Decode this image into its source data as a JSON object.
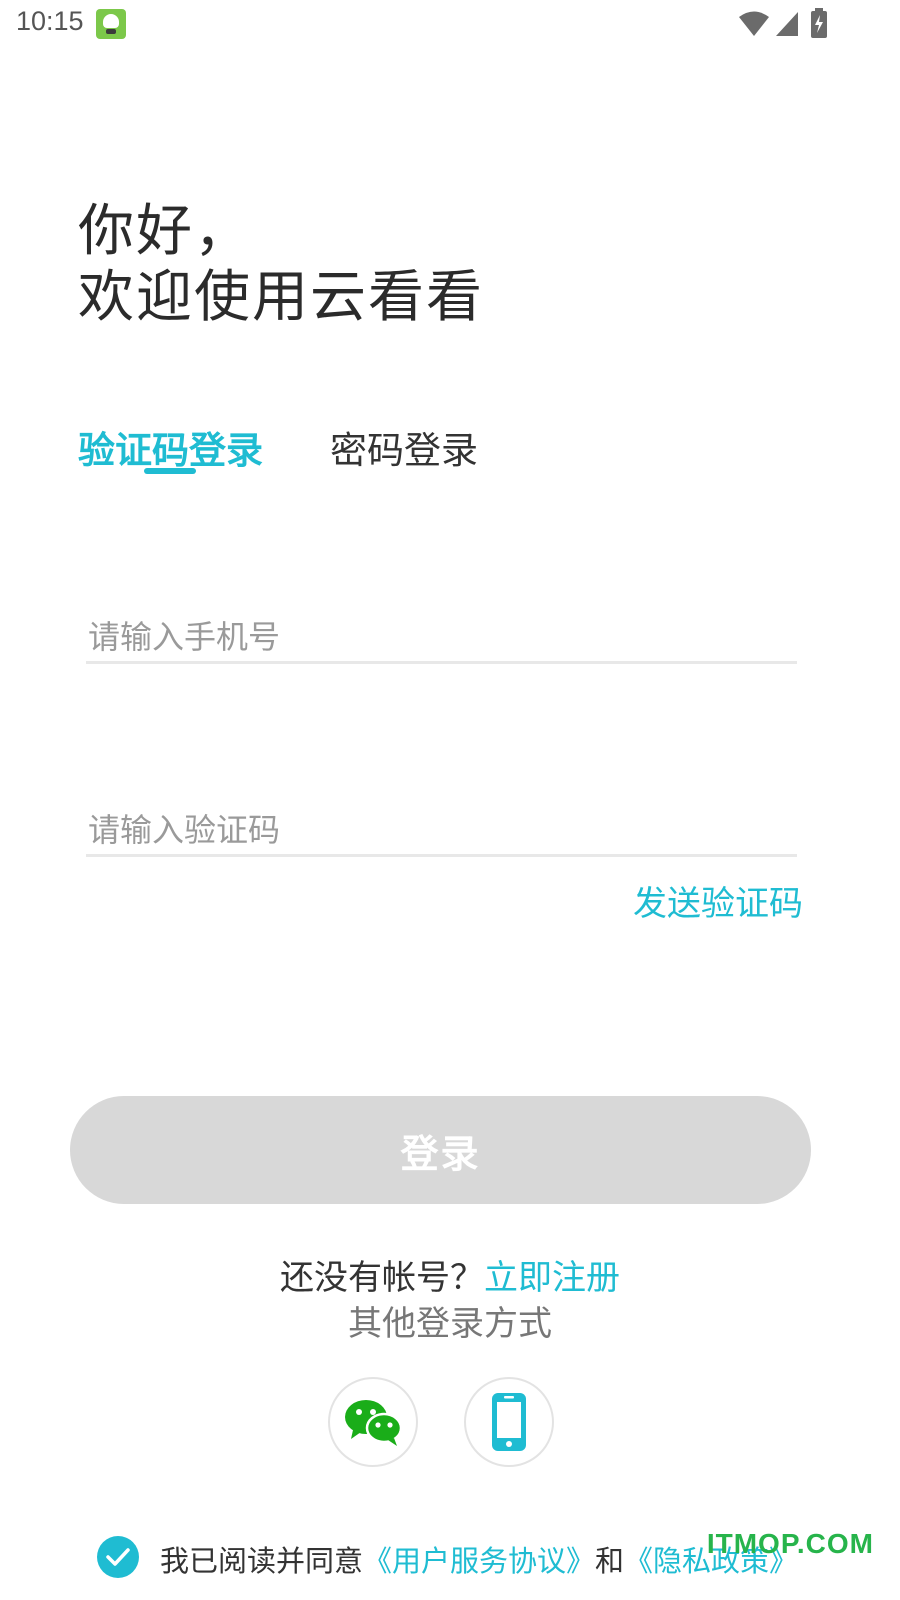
{
  "status_bar": {
    "time": "10:15",
    "icons": [
      "app-notification-icon",
      "wifi-icon",
      "cellular-signal-icon",
      "battery-charging-icon"
    ]
  },
  "welcome": {
    "line1": "你好，",
    "line2": "欢迎使用云看看"
  },
  "tabs": [
    {
      "label": "验证码登录",
      "active": true
    },
    {
      "label": "密码登录",
      "active": false
    }
  ],
  "form": {
    "phone_placeholder": "请输入手机号",
    "phone_value": "",
    "code_placeholder": "请输入验证码",
    "code_value": "",
    "send_code_label": "发送验证码"
  },
  "login_button": {
    "label": "登录",
    "enabled": false
  },
  "register": {
    "question": "还没有帐号？",
    "link": "立即注册"
  },
  "other_login": {
    "title": "其他登录方式",
    "methods": [
      "wechat-icon",
      "mobile-phone-icon"
    ]
  },
  "agreement": {
    "checked": true,
    "prefix": "我已阅读并同意",
    "service_link": "《用户服务协议》",
    "and": "和",
    "privacy_link": "《隐私政策》"
  },
  "watermark": "ITMOP.COM",
  "colors": {
    "accent": "#1fbcd2",
    "button_disabled": "#d8d8d8",
    "wechat_green": "#1aad19"
  }
}
